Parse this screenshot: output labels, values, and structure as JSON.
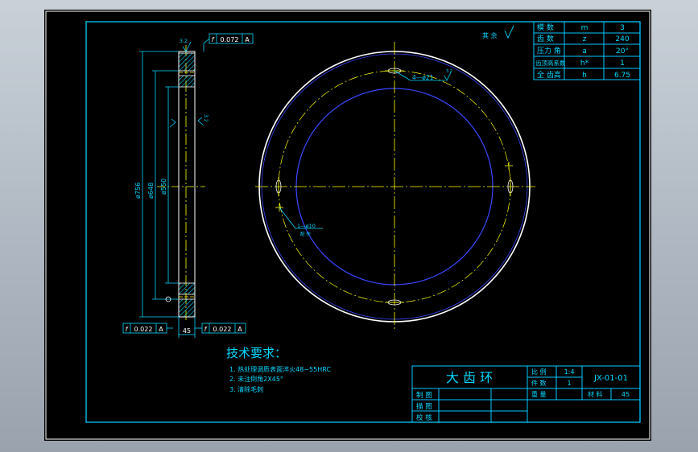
{
  "params_table": {
    "rows": [
      {
        "name": "模 数",
        "sym": "m",
        "val": "3"
      },
      {
        "name": "齿 数",
        "sym": "z",
        "val": "240"
      },
      {
        "name": "压力 角",
        "sym": "a",
        "val": "20°"
      },
      {
        "name": "齿顶高系数",
        "sym": "h*",
        "val": "1"
      },
      {
        "name": "全 齿高",
        "sym": "h",
        "val": "6.75"
      }
    ]
  },
  "roughness_note": "其 余",
  "section_view": {
    "top_tolerance": "0.072",
    "top_datum": "A",
    "bottom_left_tolerance": "0.022",
    "bottom_left_datum": "A",
    "bottom_right_tolerance": "0.022",
    "bottom_right_datum": "A",
    "flatness_symbol": "f",
    "dim_outer": "ø756",
    "dim_tip": "ø648",
    "dim_bore": "ø550",
    "dim_width": "45",
    "roughness_top": "3.2",
    "roughness_side": "3.2"
  },
  "front_view": {
    "holes_callout": "4—ø21",
    "holes_roughness": "3.2",
    "pin_callout": "1—ø10",
    "pin_note": "配 作"
  },
  "tech_requirements": {
    "title": "技术要求：",
    "items": [
      "1.   热处理调质表面淬火48~55HRC",
      "2.   未注倒角2X45°",
      "3.   清除毛刺"
    ]
  },
  "title_block": {
    "part_name": "大 齿 环",
    "scale_label": "比 例",
    "scale_value": "1:4",
    "drawing_no": "JX-01-01",
    "qty_label": "件 数",
    "qty_value": "1",
    "weight_label": "重 量",
    "material_label": "材 料",
    "material_value": "45",
    "drawn_label": "制 图",
    "traced_label": "描 图",
    "checked_label": "校 核"
  }
}
